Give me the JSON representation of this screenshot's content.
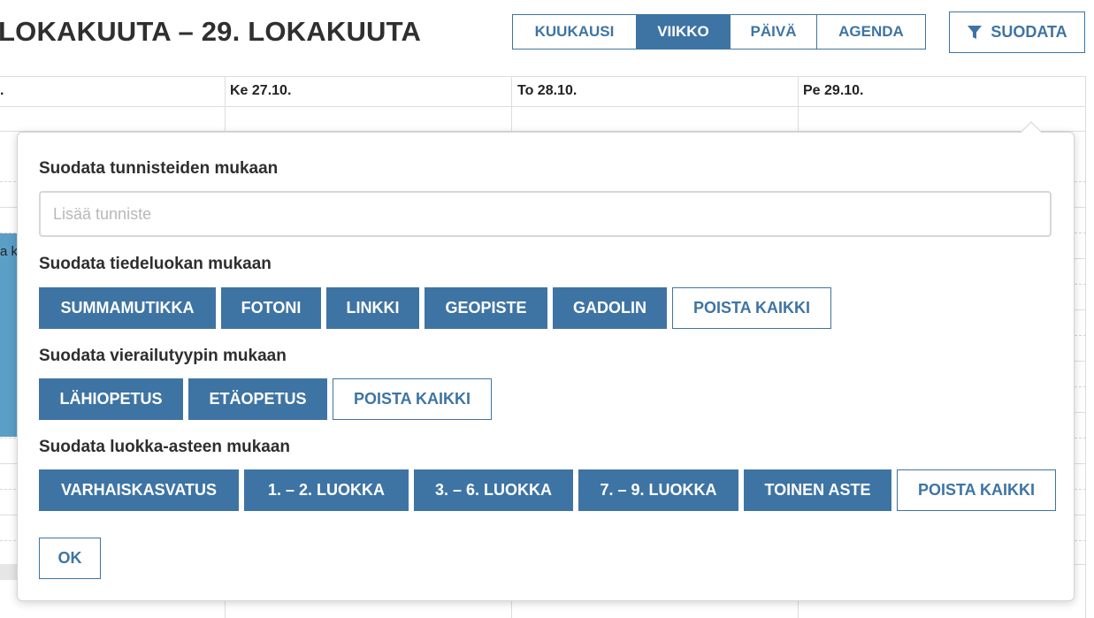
{
  "header": {
    "title": "LOKAKUUTA – 29. LOKAKUUTA",
    "views": [
      {
        "label": "KUUKAUSI",
        "active": false
      },
      {
        "label": "VIIKKO",
        "active": true
      },
      {
        "label": "PÄIVÄ",
        "active": false
      },
      {
        "label": "AGENDA",
        "active": false
      }
    ],
    "filter_label": "SUODATA"
  },
  "calendar": {
    "days": [
      ".",
      "Ke 27.10.",
      "To 28.10.",
      "Pe 29.10."
    ],
    "event_snippet": "a k"
  },
  "filter_panel": {
    "tags": {
      "title": "Suodata tunnisteiden mukaan",
      "placeholder": "Lisää tunniste"
    },
    "science_class": {
      "title": "Suodata tiedeluokan mukaan",
      "options": [
        "SUMMAMUTIKKA",
        "FOTONI",
        "LINKKI",
        "GEOPISTE",
        "GADOLIN"
      ],
      "clear_label": "POISTA KAIKKI"
    },
    "visit_type": {
      "title": "Suodata vierailutyypin mukaan",
      "options": [
        "LÄHIOPETUS",
        "ETÄOPETUS"
      ],
      "clear_label": "POISTA KAIKKI"
    },
    "grade_level": {
      "title": "Suodata luokka-asteen mukaan",
      "options": [
        "VARHAISKASVATUS",
        "1. – 2. LUOKKA",
        "3. – 6. LUOKKA",
        "7. – 9. LUOKKA",
        "TOINEN ASTE"
      ],
      "clear_label": "POISTA KAIKKI"
    },
    "ok_label": "OK"
  },
  "colors": {
    "accent": "#3e74a3",
    "event": "#5b9ec6"
  },
  "icons": {
    "filter": "filter-funnel-icon"
  }
}
